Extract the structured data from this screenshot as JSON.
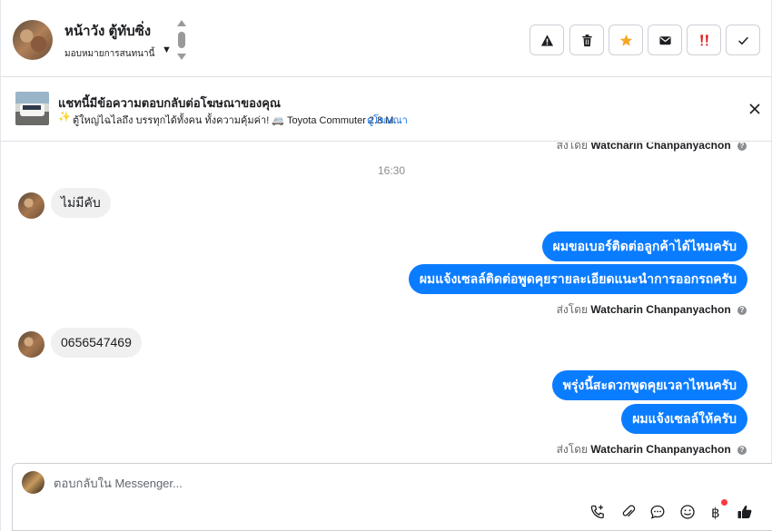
{
  "header": {
    "contact_name": "หน้าวัง ตู้ทับซิ่ง",
    "assign_label": "มอบหมายการสนทนานี้",
    "actions": {
      "spam": "spam-warning",
      "delete": "trash",
      "star": "star",
      "mail": "envelope",
      "important": "important",
      "done": "check"
    },
    "star_color": "#f5a623",
    "important_color": "#e02020"
  },
  "ad_banner": {
    "title": "แชทนี้มีข้อความตอบกลับต่อโฆษณาของคุณ",
    "sparkle": "✨",
    "text": "ตู้ใหญ่ไฉไลถึง บรรทุกได้ทั้งคน ทั้งความคุ้มค่า! 🚐 Toyota Commuter 2.8 M...",
    "link": "ดูโฆษณา"
  },
  "thread": {
    "top_sent_by": {
      "prefix": "ส่งโดย",
      "name": "Watcharin Chanpanyachon"
    },
    "time_separator": "16:30",
    "messages": [
      {
        "direction": "in",
        "text": "ไม่มีคับ"
      },
      {
        "direction": "out",
        "text": "ผมขอเบอร์ติดต่อลูกค้าได้ไหมครับ"
      },
      {
        "direction": "out",
        "text": "ผมแจ้งเซลล์ติดต่อพูดคุยรายละเอียดแนะนำการออกรถครับ"
      },
      {
        "direction": "meta",
        "prefix": "ส่งโดย",
        "name": "Watcharin Chanpanyachon"
      },
      {
        "direction": "in",
        "text": "0656547469"
      },
      {
        "direction": "out",
        "text": "พรุ่งนี้สะดวกพูดคุยเวลาไหนครับ"
      },
      {
        "direction": "out",
        "text": "ผมแจ้งเซลล์ให้ครับ"
      },
      {
        "direction": "meta",
        "prefix": "ส่งโดย",
        "name": "Watcharin Chanpanyachon"
      }
    ],
    "outgoing_color": "#0a7cff",
    "incoming_color": "#f0f0f0"
  },
  "composer": {
    "placeholder": "ตอบกลับใน Messenger...",
    "value": "",
    "tools": [
      "phone-add-icon",
      "paperclip-icon",
      "saved-reply-icon",
      "emoji-icon",
      "baht-icon",
      "like-icon"
    ]
  }
}
